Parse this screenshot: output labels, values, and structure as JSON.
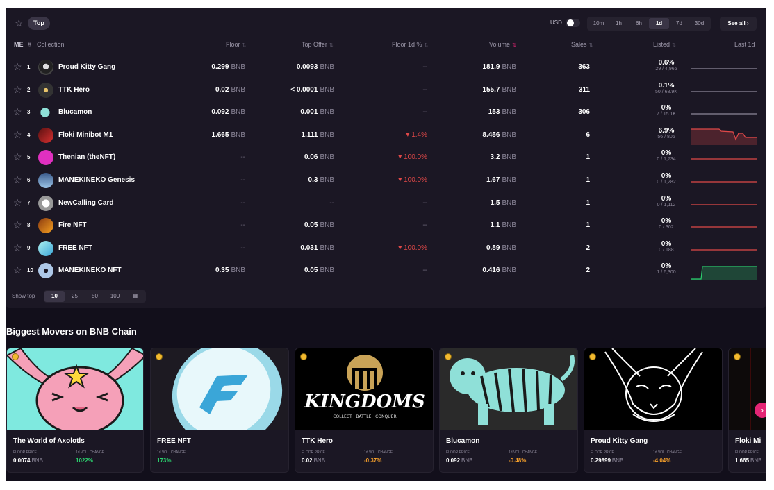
{
  "toolbar": {
    "top_chip": "Top",
    "currency": "USD",
    "periods": [
      "10m",
      "1h",
      "6h",
      "1d",
      "7d",
      "30d"
    ],
    "active_period": "1d",
    "see_all": "See all"
  },
  "table": {
    "headers": {
      "hash": "#",
      "collection": "Collection",
      "floor": "Floor",
      "top_offer": "Top Offer",
      "floor_change": "Floor 1d %",
      "volume": "Volume",
      "sales": "Sales",
      "listed": "Listed",
      "last": "Last 1d"
    },
    "unit": "BNB",
    "rows": [
      {
        "rank": "1",
        "name": "Proud Kitty Gang",
        "floor": "0.299",
        "top_offer": "0.0093",
        "change": "--",
        "volume": "181.9",
        "sales": "363",
        "listed_pct": "0.6%",
        "listed_sub": "29 / 4,966"
      },
      {
        "rank": "2",
        "name": "TTK Hero",
        "floor": "0.02",
        "top_offer": "< 0.0001",
        "change": "--",
        "volume": "155.7",
        "sales": "311",
        "listed_pct": "0.1%",
        "listed_sub": "50 / 68.9K"
      },
      {
        "rank": "3",
        "name": "Blucamon",
        "floor": "0.092",
        "top_offer": "0.001",
        "change": "--",
        "volume": "153",
        "sales": "306",
        "listed_pct": "0%",
        "listed_sub": "7 / 15.1K"
      },
      {
        "rank": "4",
        "name": "Floki Minibot M1",
        "floor": "1.665",
        "top_offer": "1.111",
        "change": "▾ 1.4%",
        "volume": "8.456",
        "sales": "6",
        "listed_pct": "6.9%",
        "listed_sub": "56 / 806"
      },
      {
        "rank": "5",
        "name": "Thenian (theNFT)",
        "floor": "--",
        "top_offer": "0.06",
        "change": "▾ 100.0%",
        "volume": "3.2",
        "sales": "1",
        "listed_pct": "0%",
        "listed_sub": "0 / 1,734"
      },
      {
        "rank": "6",
        "name": "MANEKINEKO Genesis",
        "floor": "--",
        "top_offer": "0.3",
        "change": "▾ 100.0%",
        "volume": "1.67",
        "sales": "1",
        "listed_pct": "0%",
        "listed_sub": "0 / 1,282"
      },
      {
        "rank": "7",
        "name": "NewCalling Card",
        "floor": "--",
        "top_offer": "--",
        "change": "--",
        "volume": "1.5",
        "sales": "1",
        "listed_pct": "0%",
        "listed_sub": "0 / 1,112"
      },
      {
        "rank": "8",
        "name": "Fire NFT",
        "floor": "--",
        "top_offer": "0.05",
        "change": "--",
        "volume": "1.1",
        "sales": "1",
        "listed_pct": "0%",
        "listed_sub": "0 / 302"
      },
      {
        "rank": "9",
        "name": "FREE NFT",
        "floor": "--",
        "top_offer": "0.031",
        "change": "▾ 100.0%",
        "volume": "0.89",
        "sales": "2",
        "listed_pct": "0%",
        "listed_sub": "0 / 188"
      },
      {
        "rank": "10",
        "name": "MANEKINEKO NFT",
        "floor": "0.35",
        "top_offer": "0.05",
        "change": "--",
        "volume": "0.416",
        "sales": "2",
        "listed_pct": "0%",
        "listed_sub": "1 / 6,300"
      }
    ]
  },
  "show_top": {
    "label": "Show top",
    "options": [
      "10",
      "25",
      "50",
      "100"
    ],
    "active": "10"
  },
  "movers": {
    "title": "Biggest Movers on BNB Chain",
    "floor_label": "FLOOR PRICE",
    "vol_label": "1d VOL. CHANGE",
    "cards": [
      {
        "name": "The World of Axolotls",
        "floor": "0.0074",
        "change": "1022%"
      },
      {
        "name": "FREE NFT",
        "floor": "",
        "change": "173%"
      },
      {
        "name": "TTK Hero",
        "floor": "0.02",
        "change": "-0.37%"
      },
      {
        "name": "Blucamon",
        "floor": "0.092",
        "change": "-0.48%"
      },
      {
        "name": "Proud Kitty Gang",
        "floor": "0.29899",
        "change": "-4.04%"
      },
      {
        "name": "Floki Mi",
        "floor": "1.665",
        "change": ""
      }
    ],
    "kingdoms_logo": "KINGDOMS",
    "kingdoms_tagline": "COLLECT · BATTLE · CONQUER"
  },
  "colors": {
    "bg": "#120f1b",
    "panel": "#1b1724",
    "accent": "#e42575",
    "down": "#e04848",
    "up": "#2bd36f"
  }
}
